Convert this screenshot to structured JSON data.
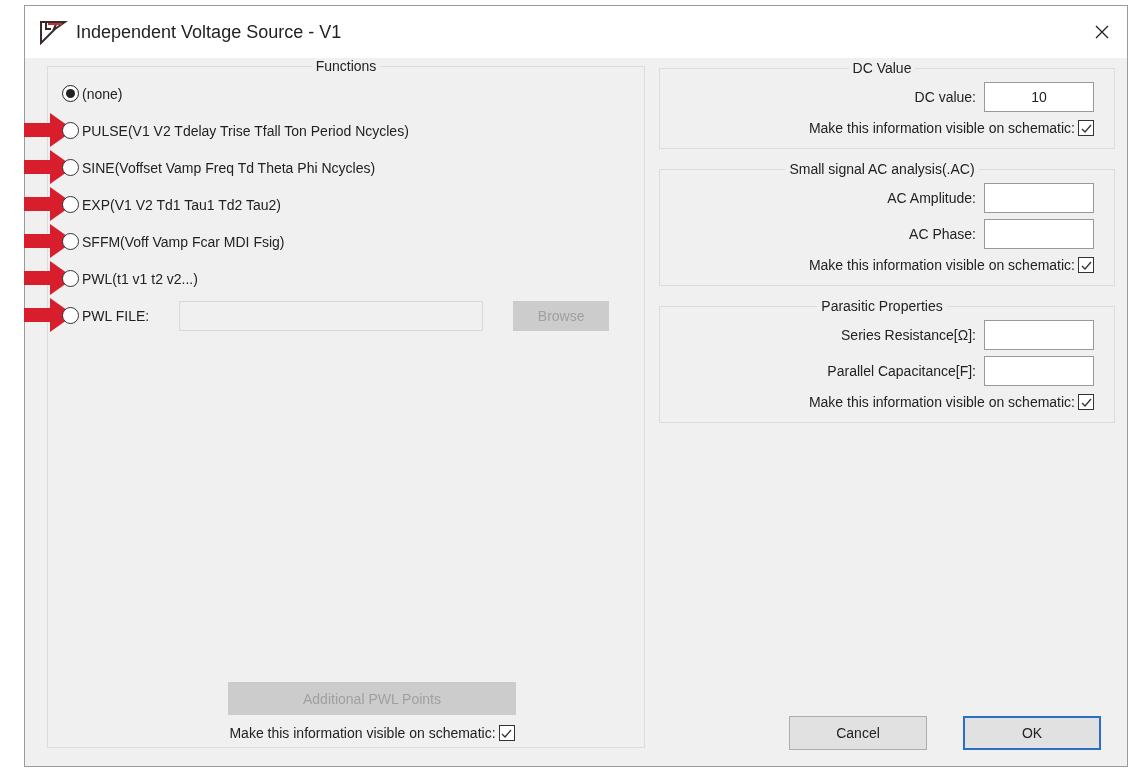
{
  "window": {
    "title": "Independent Voltage Source - V1"
  },
  "functions": {
    "title": "Functions",
    "options": [
      {
        "kind": "radio",
        "label": "(none)",
        "selected": true,
        "arrow": false
      },
      {
        "kind": "radio",
        "label": "PULSE(V1 V2 Tdelay Trise Tfall Ton Period Ncycles)",
        "selected": false,
        "arrow": true
      },
      {
        "kind": "radio",
        "label": "SINE(Voffset Vamp Freq Td Theta Phi Ncycles)",
        "selected": false,
        "arrow": true
      },
      {
        "kind": "radio",
        "label": "EXP(V1 V2 Td1 Tau1 Td2 Tau2)",
        "selected": false,
        "arrow": true
      },
      {
        "kind": "radio",
        "label": "SFFM(Voff Vamp Fcar MDI Fsig)",
        "selected": false,
        "arrow": true
      },
      {
        "kind": "radio",
        "label": "PWL(t1 v1 t2 v2...)",
        "selected": false,
        "arrow": true
      },
      {
        "kind": "file",
        "label": "PWL FILE:",
        "selected": false,
        "arrow": true,
        "button": {
          "label": "Browse",
          "disabled": true
        }
      }
    ],
    "additional_button": {
      "label": "Additional PWL Points",
      "disabled": true
    },
    "visible": {
      "label": "Make this information visible on schematic:",
      "checked": true
    }
  },
  "groups": [
    {
      "title": "DC Value",
      "fields": [
        {
          "label": "DC value:",
          "value": "10"
        }
      ],
      "visible": {
        "label": "Make this information visible on schematic:",
        "checked": true
      }
    },
    {
      "title": "Small signal AC analysis(.AC)",
      "fields": [
        {
          "label": "AC Amplitude:"
        },
        {
          "label": "AC Phase:"
        }
      ],
      "visible": {
        "label": "Make this information visible on schematic:",
        "checked": true
      }
    },
    {
      "title": "Parasitic Properties",
      "fields": [
        {
          "label": "Series Resistance[Ω]:"
        },
        {
          "label": "Parallel Capacitance[F]:"
        }
      ],
      "visible": {
        "label": "Make this information visible on schematic:",
        "checked": true
      }
    }
  ],
  "buttons": [
    {
      "label": "Cancel",
      "default": false
    },
    {
      "label": "OK",
      "default": true
    }
  ]
}
